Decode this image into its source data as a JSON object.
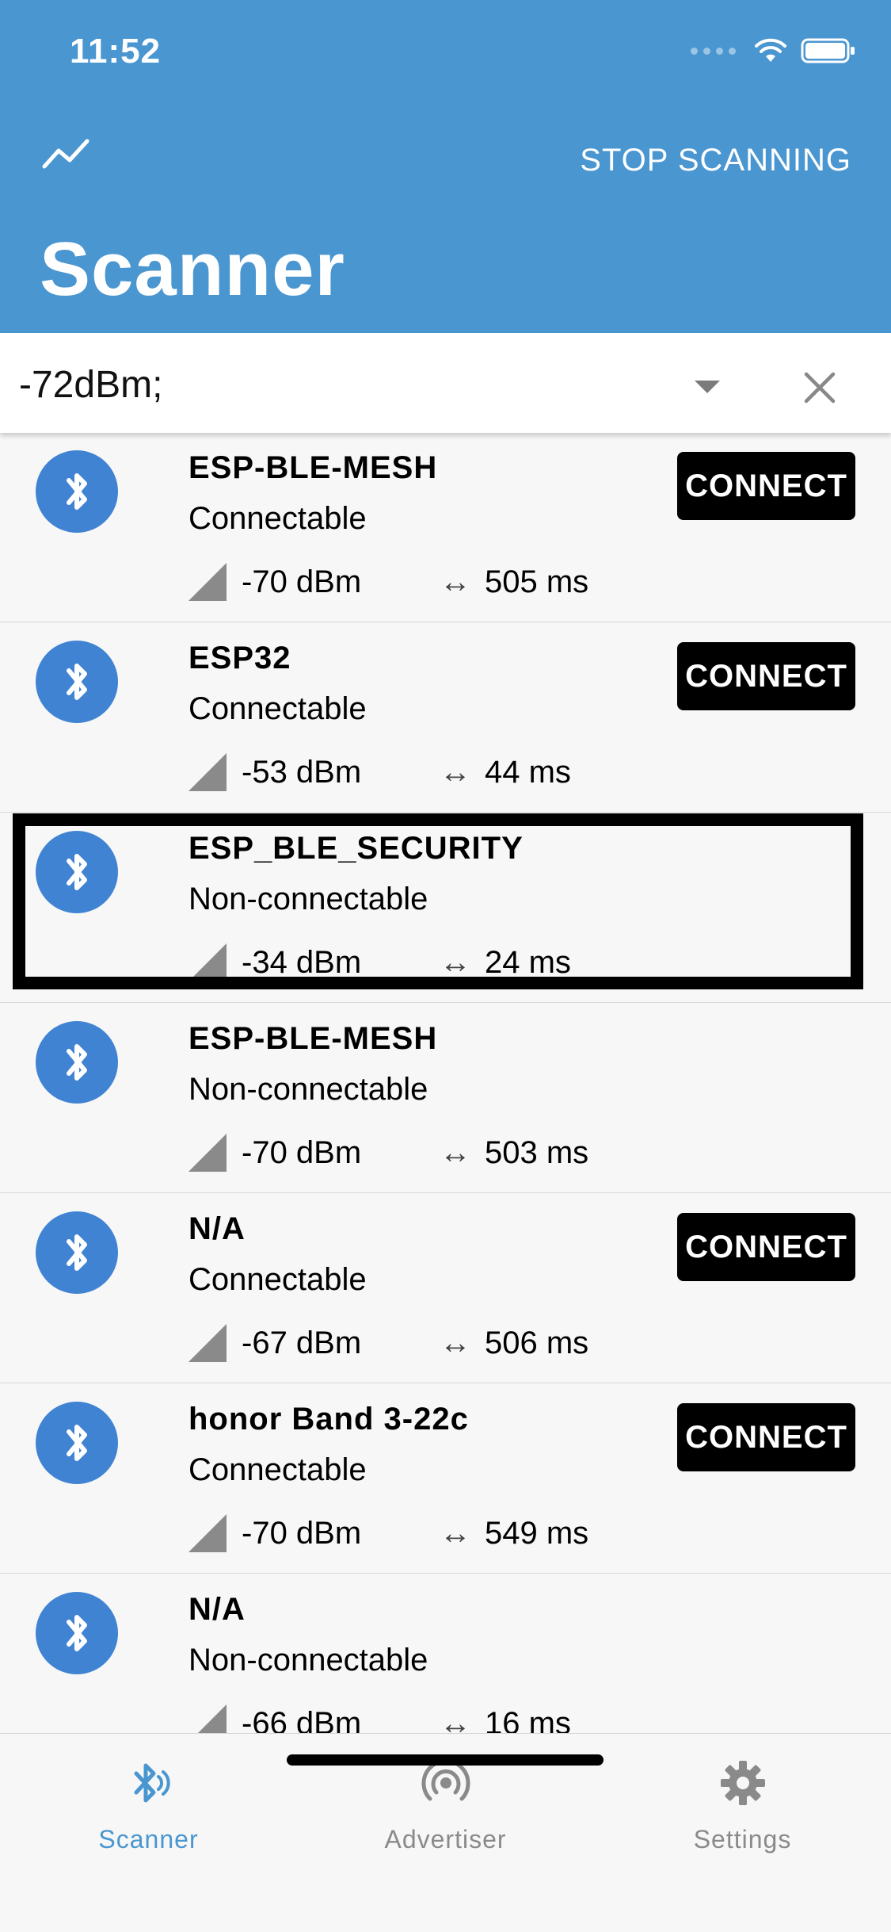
{
  "status_bar": {
    "time": "11:52"
  },
  "header": {
    "stop_label": "STOP SCANNING",
    "title": "Scanner"
  },
  "filter": {
    "value": "-72dBm;"
  },
  "devices": [
    {
      "name": "ESP-BLE-MESH",
      "state": "Connectable",
      "rssi": "-70 dBm",
      "interval": "505 ms",
      "connect": "CONNECT"
    },
    {
      "name": "ESP32",
      "state": "Connectable",
      "rssi": "-53 dBm",
      "interval": "44 ms",
      "connect": "CONNECT"
    },
    {
      "name": "ESP_BLE_SECURITY",
      "state": "Non-connectable",
      "rssi": "-34 dBm",
      "interval": "24 ms"
    },
    {
      "name": "ESP-BLE-MESH",
      "state": "Non-connectable",
      "rssi": "-70 dBm",
      "interval": "503 ms"
    },
    {
      "name": "N/A",
      "state": "Connectable",
      "rssi": "-67 dBm",
      "interval": "506 ms",
      "connect": "CONNECT"
    },
    {
      "name": "honor Band 3-22c",
      "state": "Connectable",
      "rssi": "-70 dBm",
      "interval": "549 ms",
      "connect": "CONNECT"
    },
    {
      "name": "N/A",
      "state": "Non-connectable",
      "rssi": "-66 dBm",
      "interval": "16 ms"
    }
  ],
  "tabs": [
    {
      "label": "Scanner",
      "active": true
    },
    {
      "label": "Advertiser",
      "active": false
    },
    {
      "label": "Settings",
      "active": false
    }
  ],
  "colors": {
    "header": "#4a96d0",
    "accent": "#3f83d2",
    "tab_active": "#4a96d0",
    "tab_inactive": "#8a8a8a"
  }
}
